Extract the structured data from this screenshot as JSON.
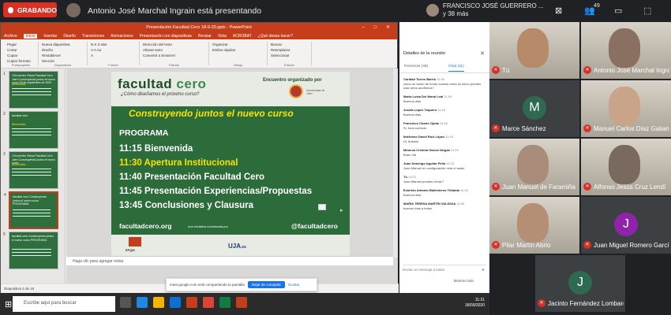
{
  "meet": {
    "recording_label": "GRABANDO",
    "presenting_text": "Antonio José Marchal Ingrain está presentando",
    "raised_hands": "FRANCISCO JOSÉ GUERRERO ...\ny 38 más",
    "participant_count": "49"
  },
  "ppt": {
    "title": "Presentación Facultad Cero 18-9-20.pptx - PowerPoint",
    "window_controls": "– □ ✕",
    "tabs": [
      "Archivo",
      "Inicio",
      "Insertar",
      "Diseño",
      "Transiciones",
      "Animaciones",
      "Presentación con diapositivas",
      "Revisar",
      "Vista",
      "ACROBAT",
      "¿Qué desea hacer?"
    ],
    "active_tab": "Inicio",
    "ribbon_groups": [
      {
        "label": "Portapapeles",
        "items": [
          "Pegar",
          "Cortar",
          "Copiar",
          "Copiar formato"
        ]
      },
      {
        "label": "Diapositivas",
        "items": [
          "Nueva diapositiva",
          "Diseño",
          "Restablecer",
          "Sección"
        ]
      },
      {
        "label": "Fuente",
        "items": [
          "N K S abe",
          "A A Aa",
          "A"
        ]
      },
      {
        "label": "Párrafo",
        "items": [
          "Dirección del texto",
          "Alinear texto",
          "Convertir a SmartArt"
        ]
      },
      {
        "label": "Dibujo",
        "items": [
          "Organizar",
          "Estilos rápidos"
        ]
      },
      {
        "label": "Edición",
        "items": [
          "Buscar",
          "Reemplazar",
          "Seleccionar"
        ]
      }
    ],
    "notes_placeholder": "Haga clic para agregar notas",
    "statusbar": "Diapositiva 4 de 15",
    "thumbs": [
      {
        "n": "1",
        "title": "I Encuentro Virtual Facultad Cero Jaén Construyendo juntos el nuevo curso 18 de septiembre de 2020",
        "sub": "Bienvenida"
      },
      {
        "n": "2",
        "title": "facultad cero",
        "sub": "Bienvenida"
      },
      {
        "n": "3",
        "title": "I Encuentro Virtual Facultad Cero Jaén Construyendo juntos el nuevo curso",
        "sub": "Bienvenida"
      },
      {
        "n": "4",
        "title": "facultad cero Construyendo juntos el nuevo curso PROGRAMA",
        "sub": ""
      },
      {
        "n": "5",
        "title": "facultad cero Construyendo juntos el nuevo curso PROGRAMA",
        "sub": ""
      }
    ]
  },
  "slide": {
    "brand_a": "facultad",
    "brand_b": "cero",
    "brand_sub": "¿Cómo diseñamos el próximo curso?",
    "organizer": "Encuentro organizado por",
    "organizer_logo_text": "Universidad de Jaén",
    "headline": "Construyendo juntos el nuevo curso",
    "program_title": "PROGRAMA",
    "items": [
      {
        "text": "11:15 Bienvenida",
        "highlight": false
      },
      {
        "text": "11:30 Apertura Institucional",
        "highlight": true
      },
      {
        "text": "11:40 Presentación Facultad Cero",
        "highlight": false
      },
      {
        "text": "11:45 Presentación Experiencias/Propuestas",
        "highlight": false
      },
      {
        "text": "13:45 Conclusiones y Clausura",
        "highlight": false
      }
    ],
    "website": "facultadcero.org",
    "initiative": "una iniciativa coordinada por",
    "twitter": "@facultadcero",
    "footer_logo_1": "EFQM",
    "footer_logo_2": "UJA",
    "footer_logo_2_suffix": ".es"
  },
  "sharebar": {
    "text": "meet.google.com está compartiendo tu pantalla",
    "stop": "Dejar de compartir",
    "hide": "Ocultar"
  },
  "chat": {
    "header": "Detalles de la reunión",
    "tab_people": "Personas (49)",
    "tab_chat": "Chat (11)",
    "messages": [
      {
        "who": "Caridad Torres Barrio",
        "time": "11:16",
        "text": "como un fondo de fondo cuando entra mi micro puedes usar otros audífonos?"
      },
      {
        "who": "María Luisa Del Moral Leal",
        "time": "11:16",
        "text": "Buenos días"
      },
      {
        "who": "Josefa López Toquero",
        "time": "11:16",
        "text": "Buenos días"
      },
      {
        "who": "Francisco Charte Ojeda",
        "time": "11:18",
        "text": "Sí, todo correcto"
      },
      {
        "who": "Ildefonso David Ruiz López",
        "time": "11:19",
        "text": "Hi, Antonio"
      },
      {
        "who": "Minerva Cristina García Vargas",
        "time": "11:19",
        "text": "Buen día"
      },
      {
        "who": "Juan Domingo Aguilar Peña",
        "time": "11:23",
        "text": "Juan Manuel en configuración mira el audio"
      },
      {
        "who": "Tú",
        "time": "11:23",
        "text": "Juan Manuel puedes cerrar?"
      },
      {
        "who": "Evaristo Antonio Ballesteros Tribaldo",
        "time": "11:31",
        "text": "Buenos días"
      },
      {
        "who": "MARÍA TERESA MARTÍN VALDIVIA",
        "time": "11:30",
        "text": "buenos días a todos"
      }
    ],
    "input_placeholder": "Enviar un mensaje a todos",
    "footer": "Mostrar todo"
  },
  "taskbar": {
    "search_placeholder": "Escribe aquí para buscar",
    "clock": "11:31\n18/09/2020"
  },
  "participants": [
    {
      "name": "Tú",
      "letter": "",
      "color": "#b78a6a"
    },
    {
      "name": "Antonio José Marchal Ingrain",
      "letter": "",
      "color": "#8a7060"
    },
    {
      "name": "Marce Sánchez",
      "letter": "M",
      "color": "#2d6a4f"
    },
    {
      "name": "Manuel Carlos Díaz Galiano",
      "letter": "",
      "color": "#c9a488"
    },
    {
      "name": "Juan Manuel de Faramiña",
      "letter": "",
      "color": "#a98c7a"
    },
    {
      "name": "Alfonso Jesús Cruz Lendí",
      "letter": "",
      "color": "#7a6a5e"
    },
    {
      "name": "Pilar Martín Abrio",
      "letter": "",
      "color": "#b58f74"
    },
    {
      "name": "Juan Miguel Romero García",
      "letter": "J",
      "color": "#8e24aa"
    },
    {
      "name": "Jacinto Fernández Lombardo",
      "letter": "J",
      "color": "#2d6a4f"
    }
  ]
}
